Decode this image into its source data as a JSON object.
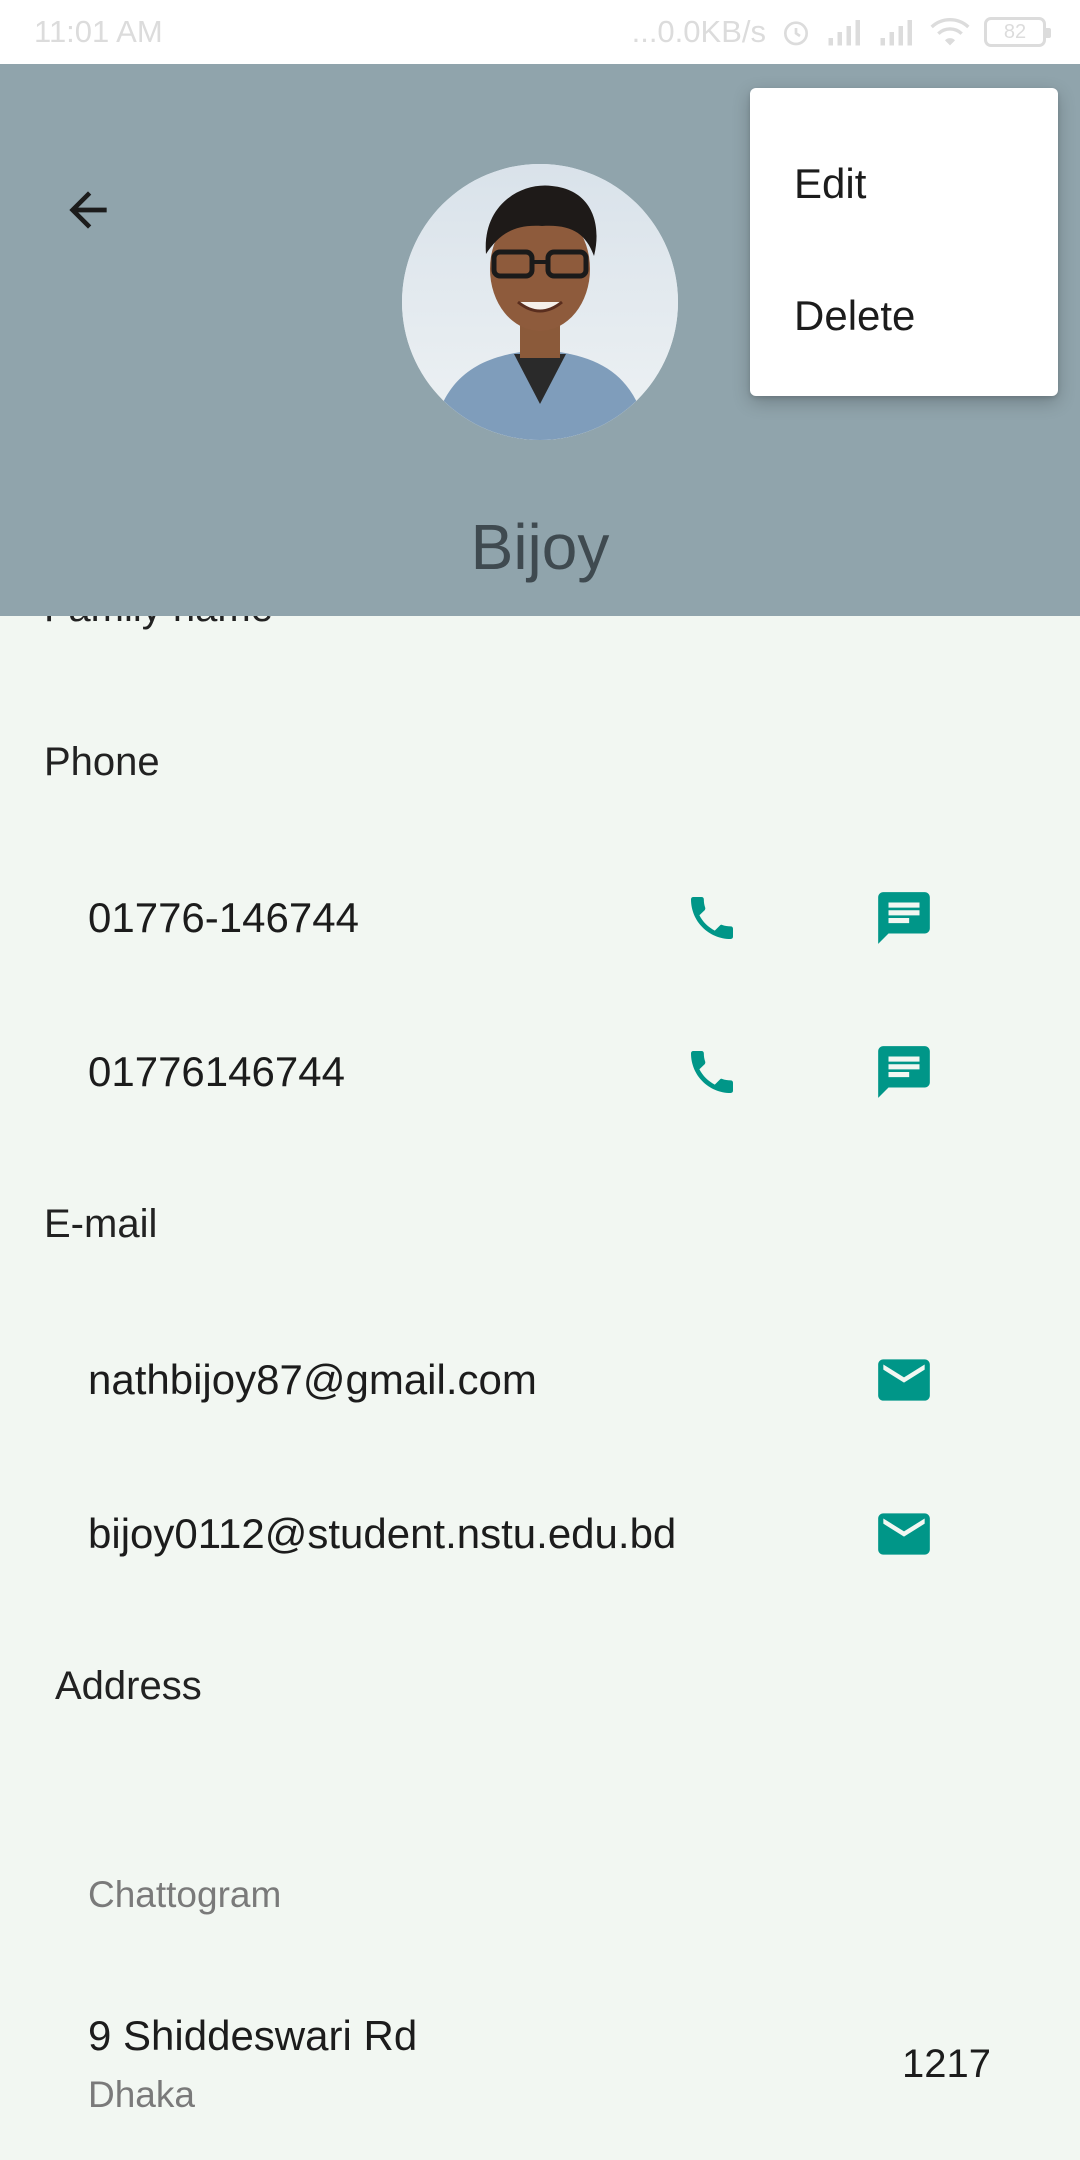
{
  "status_bar": {
    "time": "11:01 AM",
    "network_speed": "...0.0KB/s",
    "battery_level": "82",
    "icons": [
      "alarm-icon",
      "signal-icon",
      "signal-icon",
      "wifi-icon",
      "battery-icon"
    ]
  },
  "header": {
    "name": "Bijoy",
    "background_color": "#90a4ac"
  },
  "menu": {
    "items": [
      {
        "label": "Edit"
      },
      {
        "label": "Delete"
      }
    ]
  },
  "partial_field_label": "Family name",
  "phone": {
    "label": "Phone",
    "numbers": [
      {
        "value": "01776-146744",
        "call_icon": "phone-icon",
        "message_icon": "message-icon"
      },
      {
        "value": "01776146744",
        "call_icon": "phone-icon",
        "message_icon": "message-icon"
      }
    ]
  },
  "email": {
    "label": "E-mail",
    "addresses": [
      {
        "value": "nathbijoy87@gmail.com",
        "icon": "email-icon"
      },
      {
        "value": "bijoy0112@student.nstu.edu.bd",
        "icon": "email-icon"
      }
    ]
  },
  "address": {
    "label": "Address",
    "entries": [
      {
        "region": "Chattogram"
      },
      {
        "street": "9 Shiddeswari Rd",
        "city": "Dhaka",
        "postcode": "1217"
      }
    ]
  },
  "accent_color": "#009688"
}
